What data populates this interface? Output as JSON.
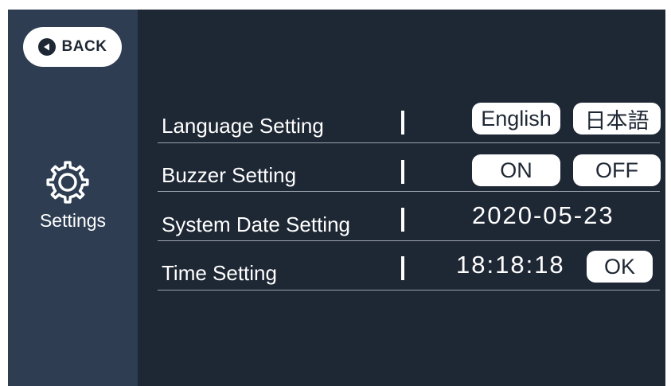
{
  "back_button": {
    "label": "BACK",
    "icon": "back-arrow-circle-icon"
  },
  "sidebar": {
    "icon": "gear-icon",
    "label": "Settings"
  },
  "settings": {
    "language": {
      "label": "Language Setting",
      "options": [
        "English",
        "日本語"
      ]
    },
    "buzzer": {
      "label": "Buzzer Setting",
      "options": [
        "ON",
        "OFF"
      ]
    },
    "system_date": {
      "label": "System Date Setting",
      "value": "2020-05-23"
    },
    "time": {
      "label": "Time Setting",
      "value": "18:18:18",
      "confirm_label": "OK"
    }
  },
  "colors": {
    "background": "#1e2734",
    "sidebar": "#2e3d52",
    "text": "#ffffff",
    "button": "#ffffff"
  }
}
